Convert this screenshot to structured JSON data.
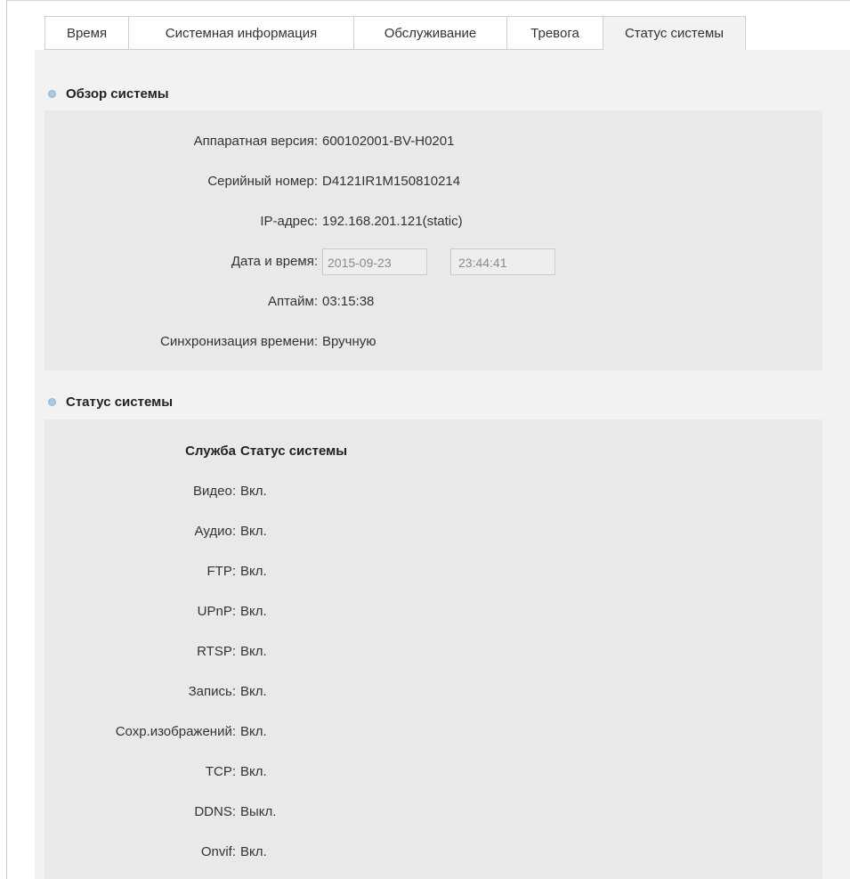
{
  "tabs": [
    {
      "label": "Время",
      "active": false
    },
    {
      "label": "Системная информация",
      "active": false
    },
    {
      "label": "Обслуживание",
      "active": false
    },
    {
      "label": "Тревога",
      "active": false
    },
    {
      "label": "Статус системы",
      "active": true
    }
  ],
  "overview": {
    "title": "Обзор системы",
    "hardware_label": "Аппаратная версия:",
    "hardware_value": "600102001-BV-H0201",
    "serial_label": "Серийный номер:",
    "serial_value": "D4121IR1M150810214",
    "ip_label": "IP-адрес:",
    "ip_value": "192.168.201.121(static)",
    "datetime_label": "Дата и время:",
    "date_value": "2015-09-23",
    "time_value": "23:44:41",
    "uptime_label": "Аптайм:",
    "uptime_value": "03:15:38",
    "sync_label": "Синхронизация времени:",
    "sync_value": "Вручную"
  },
  "status": {
    "title": "Статус системы",
    "header_service": "Служба",
    "header_status": "Статус системы",
    "services": [
      {
        "label": "Видео:",
        "value": "Вкл."
      },
      {
        "label": "Аудио:",
        "value": "Вкл."
      },
      {
        "label": "FTP:",
        "value": "Вкл."
      },
      {
        "label": "UPnP:",
        "value": "Вкл."
      },
      {
        "label": "RTSP:",
        "value": "Вкл."
      },
      {
        "label": "Запись:",
        "value": "Вкл."
      },
      {
        "label": "Сохр.изображений:",
        "value": "Вкл."
      },
      {
        "label": "TCP:",
        "value": "Вкл."
      },
      {
        "label": "DDNS:",
        "value": "Выкл."
      },
      {
        "label": "Onvif:",
        "value": "Вкл."
      }
    ]
  },
  "colors": {
    "panel_bg": "#f2f2f2",
    "box_bg": "#e9e9e9",
    "bullet": "#a9c9e6"
  }
}
